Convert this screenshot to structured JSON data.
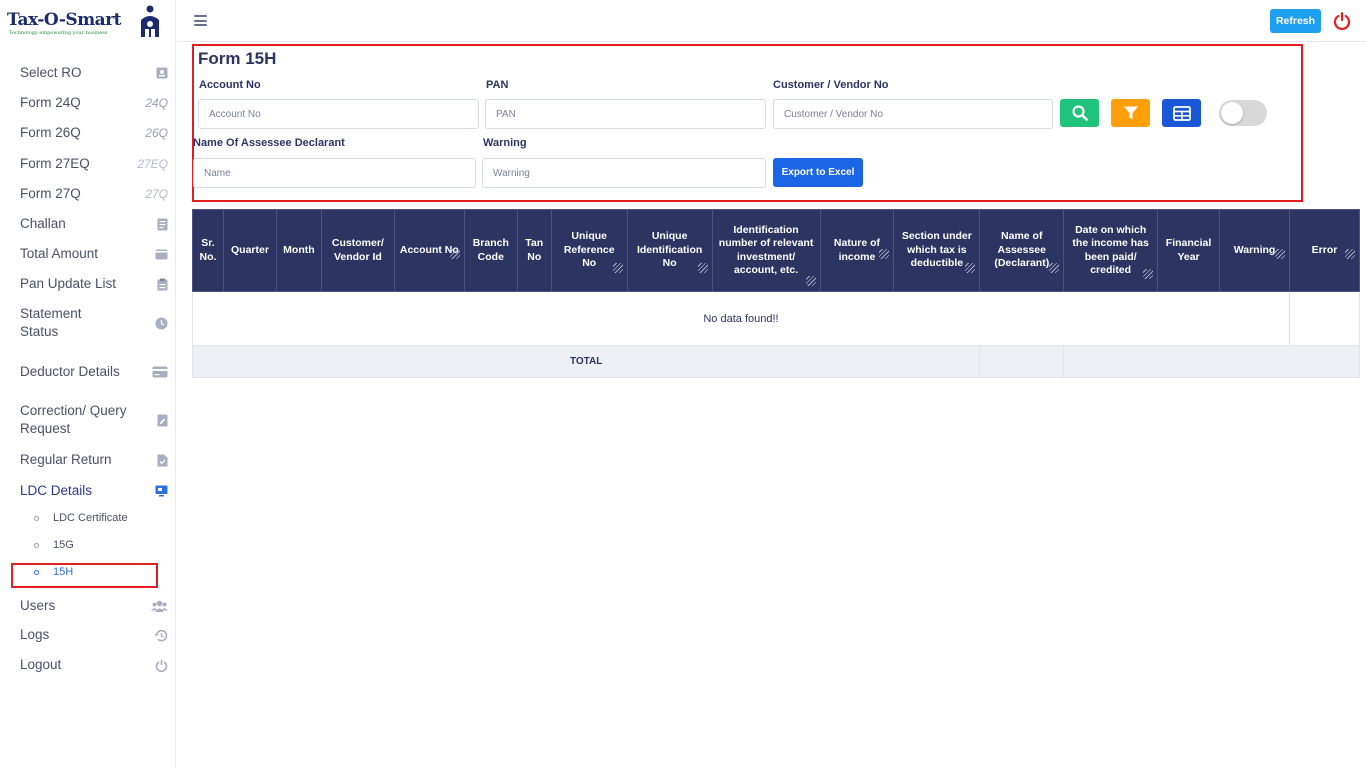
{
  "app": {
    "logo_text": "Tax-O-Smart",
    "logo_tagline": "Technology empowering your business"
  },
  "sidebar": {
    "items": [
      {
        "label": "Select RO",
        "icon": "id-card-icon"
      },
      {
        "label": "Form 24Q",
        "tag": "24Q"
      },
      {
        "label": "Form 26Q",
        "tag": "26Q"
      },
      {
        "label": "Form 27EQ",
        "tag": "27EQ"
      },
      {
        "label": "Form 27Q",
        "tag": "27Q"
      },
      {
        "label": "Challan",
        "icon": "receipt-icon"
      },
      {
        "label": "Total Amount",
        "icon": "wallet-icon"
      },
      {
        "label": "Pan Update List",
        "icon": "clipboard-icon"
      },
      {
        "label": "Statement Status",
        "icon": "clock-icon"
      },
      {
        "label": "Deductor Details",
        "icon": "credit-card-icon"
      },
      {
        "label": "Correction/ Query Request",
        "icon": "file-edit-icon"
      },
      {
        "label": "Regular Return",
        "icon": "file-check-icon"
      },
      {
        "label": "LDC Details",
        "icon": "monitor-icon"
      },
      {
        "label": "Users",
        "icon": "users-icon"
      },
      {
        "label": "Logs",
        "icon": "history-icon"
      },
      {
        "label": "Logout",
        "icon": "power-icon"
      }
    ],
    "sub_items": [
      "LDC Certificate",
      "15G",
      "15H"
    ]
  },
  "topbar": {
    "refresh_label": "Refresh"
  },
  "form": {
    "title": "Form 15H",
    "account_label": "Account No",
    "account_placeholder": "Account No",
    "pan_label": "PAN",
    "pan_placeholder": "PAN",
    "customer_label": "Customer / Vendor No",
    "customer_placeholder": "Customer / Vendor No",
    "name_label": "Name Of Assessee Declarant",
    "name_placeholder": "Name",
    "warning_label": "Warning",
    "warning_placeholder": "Warning",
    "export_label": "Export to Excel",
    "colors": {
      "search": "#1fc37a",
      "filter": "#ff9f0a",
      "grid": "#1a57d6"
    }
  },
  "table": {
    "headers": [
      "Sr. No.",
      "Quarter",
      "Month",
      "Customer/ Vendor Id",
      "Account No",
      "Branch Code",
      "Tan No",
      "Unique Reference No",
      "Unique Identification No",
      "Identification number of relevant investment/ account, etc.",
      "Nature of income",
      "Section under which tax is deductible",
      "Name of Assessee (Declarant)",
      "Date on which the income has been paid/ credited",
      "Financial Year",
      "Warning",
      "Error"
    ],
    "empty_message": "No data found!!",
    "total_label": "TOTAL"
  }
}
